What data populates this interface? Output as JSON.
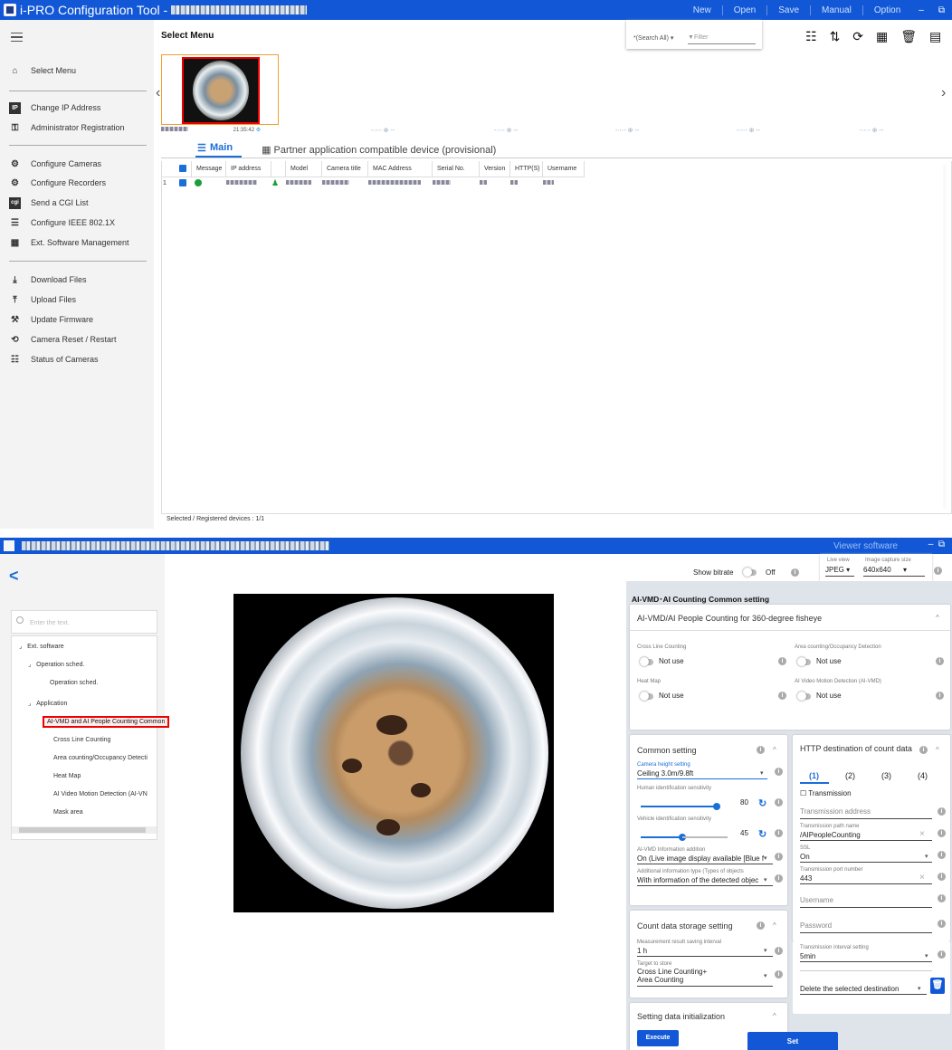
{
  "tool": {
    "title": "i-PRO Configuration Tool -",
    "menu": [
      "New",
      "Open",
      "Save",
      "Manual",
      "Option"
    ],
    "min": "–",
    "restore": "⧉",
    "sidebar": {
      "items": [
        {
          "icon": "home-icon",
          "glyph": "⌂",
          "label": "Select Menu"
        },
        {
          "icon": "ip-icon",
          "glyph": "IP",
          "label": "Change IP Address"
        },
        {
          "icon": "admin-icon",
          "glyph": "⚿",
          "label": "Administrator Registration"
        },
        {
          "icon": "camera-config-icon",
          "glyph": "⚙",
          "label": "Configure Cameras"
        },
        {
          "icon": "recorder-config-icon",
          "glyph": "⚙",
          "label": "Configure Recorders"
        },
        {
          "icon": "cgi-icon",
          "glyph": "cgi",
          "label": "Send a CGI List"
        },
        {
          "icon": "ieee-icon",
          "glyph": "☰",
          "label": "Configure IEEE 802.1X"
        },
        {
          "icon": "ext-software-icon",
          "glyph": "▦",
          "label": "Ext. Software Management"
        },
        {
          "icon": "download-icon",
          "glyph": "⤓",
          "label": "Download Files"
        },
        {
          "icon": "upload-icon",
          "glyph": "⤒",
          "label": "Upload Files"
        },
        {
          "icon": "firmware-icon",
          "glyph": "⚒",
          "label": "Update Firmware"
        },
        {
          "icon": "reset-icon",
          "glyph": "⟲",
          "label": "Camera Reset / Restart"
        },
        {
          "icon": "status-icon",
          "glyph": "☷",
          "label": "Status of Cameras"
        }
      ]
    },
    "main": {
      "title": "Select Menu",
      "search_scope": "*(Search All)",
      "filter_placeholder": "Filter",
      "thumb_time": "21:35:42",
      "tabs": {
        "main": "Main",
        "partner": "Partner application compatible device (provisional)"
      },
      "columns": [
        "Message",
        "IP address",
        "Model",
        "Camera title",
        "MAC Address",
        "Serial No.",
        "Version",
        "HTTP(S)",
        "Username"
      ],
      "row_index": "1",
      "status": "Selected / Registered devices : 1/1"
    }
  },
  "viewer": {
    "title": "Viewer software",
    "show_bitrate": "Show bitrate",
    "bitrate_state": "Off",
    "live_view_label": "Live view",
    "live_view_value": "JPEG",
    "capture_label": "Image capture size",
    "capture_value": "640x640",
    "filter_placeholder": "Enter the text.",
    "tree": [
      "Ext. software",
      "Operation sched.",
      "Operation sched.",
      "Application",
      "AI-VMD and AI People Counting  Common",
      "Cross Line Counting",
      "Area counting/Occupancy Detecti",
      "Heat Map",
      "AI Video Motion Detection (AI-VN",
      "Mask area"
    ],
    "panel_title": "AI-VMD･AI Counting Common setting",
    "fisheye_card": {
      "title": "AI-VMD/AI People Counting for 360-degree fisheye",
      "cross_line_label": "Cross Line Counting",
      "cross_line_value": "Not use",
      "area_label": "Area counting/Occupancy Detection",
      "area_value": "Not use",
      "heat_label": "Heat Map",
      "heat_value": "Not use",
      "vmd_label": "AI Video Motion Detection (AI-VMD)",
      "vmd_value": "Not use"
    },
    "common": {
      "title": "Common setting",
      "height_label": "Camera height setting",
      "height_value": "Ceiling 3.0m/9.8ft",
      "human_label": "Human identification sensitivity",
      "human_value": "80",
      "vehicle_label": "Vehicle identification sensitivity",
      "vehicle_value": "45",
      "info_add_label": "AI-VMD Information addition",
      "info_add_value": "On (Live image display available [Blue f",
      "add_type_label": "Additional information type (Types of objects",
      "add_type_value": "With information of the detected objec"
    },
    "storage": {
      "title": "Count data storage setting",
      "interval_label": "Measurement result saving interval",
      "interval_value": "1 h",
      "target_label": "Target to store",
      "target_value_1": "Cross Line Counting+",
      "target_value_2": "Area Counting"
    },
    "init": {
      "title": "Setting data initialization",
      "execute": "Execute"
    },
    "http": {
      "title": "HTTP destination of count data",
      "tabs": [
        "(1)",
        "(2)",
        "(3)",
        "(4)"
      ],
      "transmission": "Transmission",
      "address_placeholder": "Transmission address",
      "path_label": "Transmission path name",
      "path_value": "/AIPeopleCounting",
      "ssl_label": "SSL",
      "ssl_value": "On",
      "port_label": "Transmission port number",
      "port_value": "443",
      "username_placeholder": "Username",
      "password_placeholder": "Password",
      "interval_label": "Transmission interval setting",
      "interval_value": "5min",
      "delete_label": "Delete the selected destination"
    },
    "set": "Set"
  }
}
